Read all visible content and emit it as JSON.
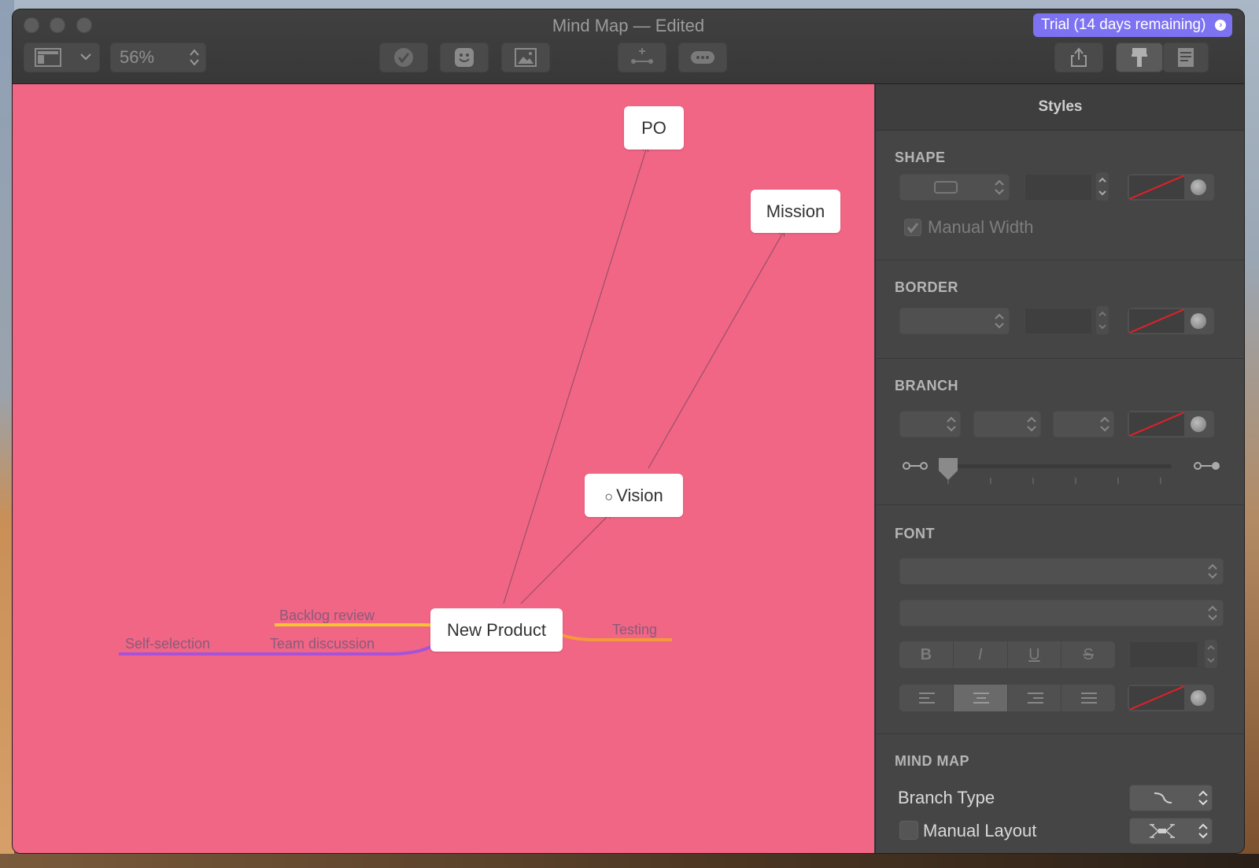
{
  "window": {
    "title": "Mind Map — Edited",
    "trial_label": "Trial (14 days remaining)"
  },
  "toolbar": {
    "zoom_value": "56%",
    "icons": [
      "sidebar-icon",
      "chevron-down-icon",
      "checkmark-icon",
      "emoji-icon",
      "image-icon",
      "add-child-icon",
      "comment-icon",
      "share-icon",
      "paintbrush-icon",
      "notes-icon"
    ]
  },
  "canvas": {
    "background": "#f16585",
    "nodes": {
      "po": "PO",
      "mission": "Mission",
      "vision": "Vision",
      "vision_marker": "○",
      "root": "New Product"
    },
    "branch_labels": {
      "backlog": "Backlog review",
      "team": "Team discussion",
      "self": "Self-selection",
      "testing": "Testing"
    },
    "branch_colors": {
      "backlog": "#f3c52f",
      "team": "#a653d9",
      "testing": "#f49a3c"
    }
  },
  "styles_panel": {
    "title": "Styles",
    "shape": {
      "title": "SHAPE",
      "manual_width_label": "Manual Width",
      "manual_width_checked": true
    },
    "border": {
      "title": "BORDER"
    },
    "branch": {
      "title": "BRANCH"
    },
    "font": {
      "title": "FONT",
      "bold": "B",
      "italic": "I",
      "underline": "U",
      "strike": "S"
    },
    "mind_map": {
      "title": "MIND MAP",
      "branch_type_label": "Branch Type",
      "manual_layout_label": "Manual Layout",
      "manual_layout_checked": false
    }
  }
}
